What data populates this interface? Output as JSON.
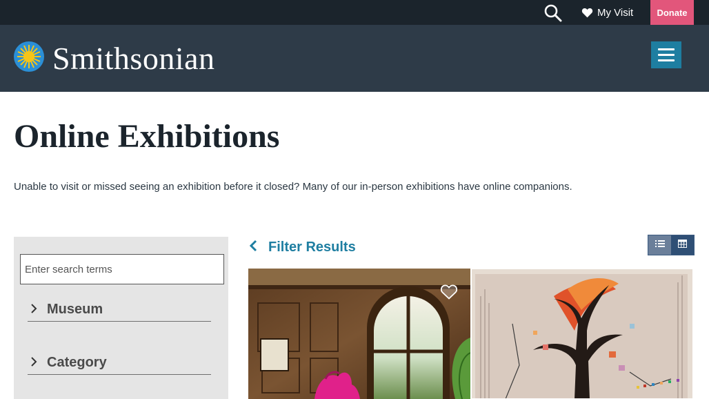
{
  "topbar": {
    "search_icon": "search-icon",
    "my_visit_label": "My Visit",
    "heart_icon": "heart-icon",
    "donate_label": "Donate",
    "colors": {
      "background": "#1b242c",
      "donate": "#e2567b"
    }
  },
  "header": {
    "logo_text": "Smithsonian",
    "logo_icon": "sun-icon",
    "menu_icon": "hamburger-icon",
    "colors": {
      "background": "#2e3b48",
      "menu": "#1e7ea1"
    }
  },
  "page": {
    "title": "Online Exhibitions",
    "intro": "Unable to visit or missed seeing an exhibition before it closed? Many of our in-person exhibitions have online companions."
  },
  "sidebar": {
    "search_placeholder": "Enter search terms",
    "facets": [
      {
        "label": "Museum",
        "icon": "chevron-right-icon"
      },
      {
        "label": "Category",
        "icon": "chevron-right-icon"
      }
    ]
  },
  "results": {
    "filter_label": "Filter Results",
    "back_icon": "chevron-left-icon",
    "view_list_icon": "list-view-icon",
    "view_grid_icon": "grid-view-icon",
    "active_view": "grid",
    "accent": "#1e7ea1",
    "cards": [
      {
        "image": "historic-room-with-window",
        "favorite_icon": "heart-outline-icon"
      },
      {
        "image": "textile-tree-artwork"
      }
    ]
  }
}
